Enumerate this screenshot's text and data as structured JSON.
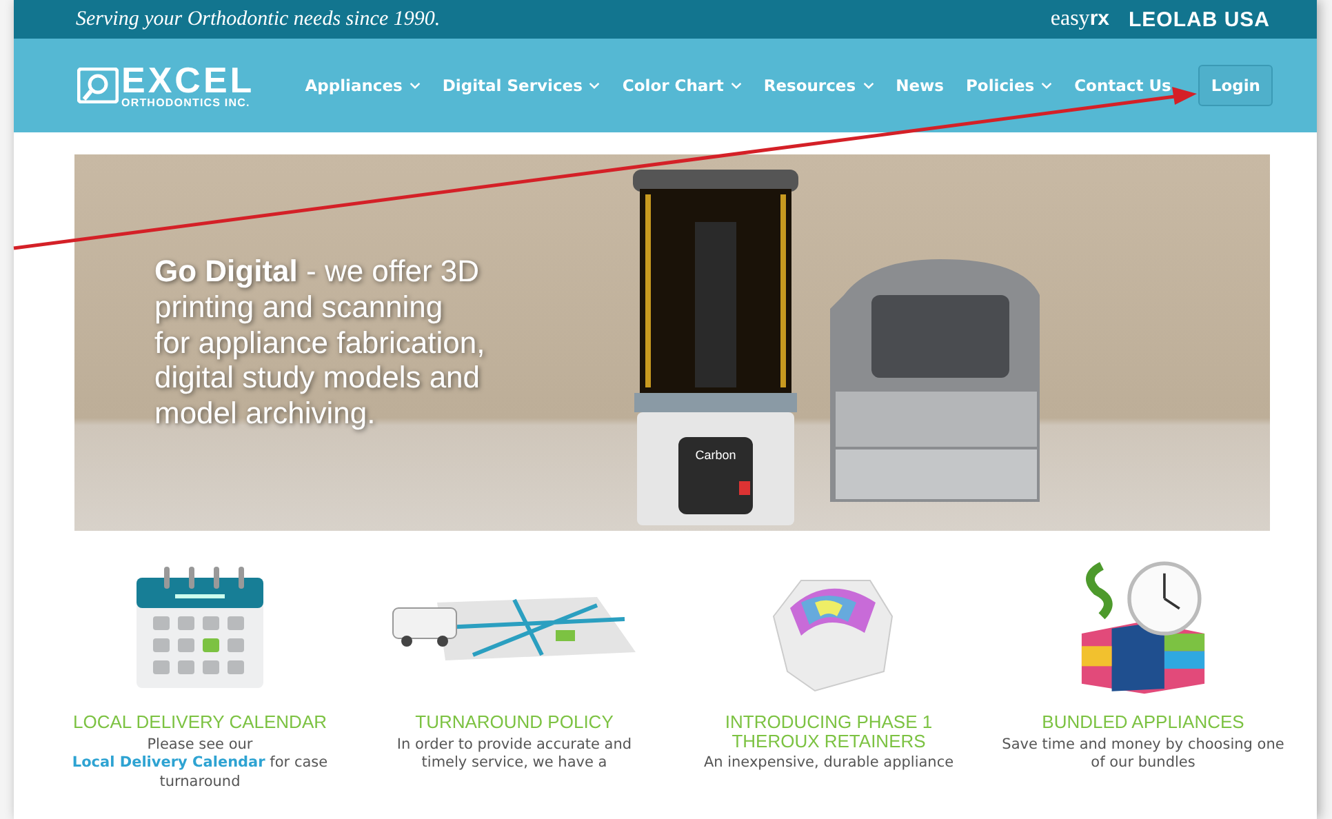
{
  "top_bar": {
    "tagline": "Serving your Orthodontic needs since 1990.",
    "links": [
      {
        "kind": "easyrx",
        "parts": [
          "easy",
          "rx"
        ]
      },
      {
        "kind": "plain",
        "parts": [
          "LEOLAB USA"
        ]
      }
    ]
  },
  "logo": {
    "name": "EXCEL",
    "subtitle": "ORTHODONTICS INC."
  },
  "nav": {
    "items": [
      {
        "label": "Appliances",
        "dropdown": true
      },
      {
        "label": "Digital Services",
        "dropdown": true
      },
      {
        "label": "Color Chart",
        "dropdown": true
      },
      {
        "label": "Resources",
        "dropdown": true
      },
      {
        "label": "News",
        "dropdown": false
      },
      {
        "label": "Policies",
        "dropdown": true
      },
      {
        "label": "Contact Us",
        "dropdown": false
      }
    ],
    "login": "Login"
  },
  "hero": {
    "headline": "**Go Digital** - we offer 3D\nprinting and scanning\nfor appliance fabrication,\ndigital study models and\nmodel archiving.",
    "printer_label": "Carbon"
  },
  "features": [
    {
      "kind": "calendar",
      "title": "LOCAL DELIVERY CALENDAR",
      "text_before": "Please see our",
      "link": "Local Delivery Calendar",
      "text_after": "for case turnaround"
    },
    {
      "kind": "map",
      "title": "TURNAROUND POLICY",
      "text_before": "In order to provide accurate and timely service, we have a"
    },
    {
      "kind": "retainer",
      "title": "INTRODUCING PHASE 1 THEROUX RETAINERS",
      "text_before": "An inexpensive, durable appliance"
    },
    {
      "kind": "bundle",
      "title": "BUNDLED APPLIANCES",
      "text_before": "Save time and money by choosing one of our bundles"
    }
  ]
}
